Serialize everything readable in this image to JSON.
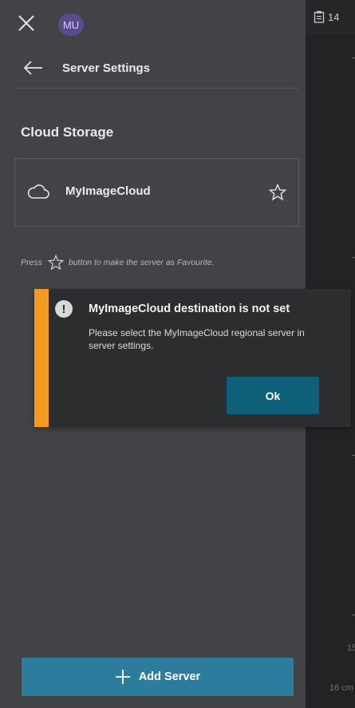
{
  "topbar": {
    "close_icon": "close-icon",
    "avatar_initials": "MU"
  },
  "header": {
    "back_icon": "arrow-left-icon",
    "title": "Server Settings"
  },
  "section": {
    "title": "Cloud Storage"
  },
  "storage_item": {
    "icon": "cloud-icon",
    "label": "MyImageCloud",
    "favorite_icon": "star-outline-icon"
  },
  "hint": {
    "before": "Press",
    "after": "button to make the server as Favourite."
  },
  "alert": {
    "icon": "exclamation-icon",
    "icon_glyph": "!",
    "title": "MyImageCloud destination is not set",
    "message": "Please select the MyImageCloud regional server in server settings.",
    "ok_label": "Ok",
    "stripe_color": "#f29b1f"
  },
  "footer": {
    "add_label": "Add Server",
    "add_icon": "plus-icon"
  },
  "background": {
    "clip_count": "14",
    "bottom_number": "15",
    "bottom_text": "16 cm"
  },
  "colors": {
    "panel": "#424346",
    "accent_button": "#2b7c9d",
    "dialog_button": "#0e5f79",
    "warning": "#f29b1f"
  }
}
